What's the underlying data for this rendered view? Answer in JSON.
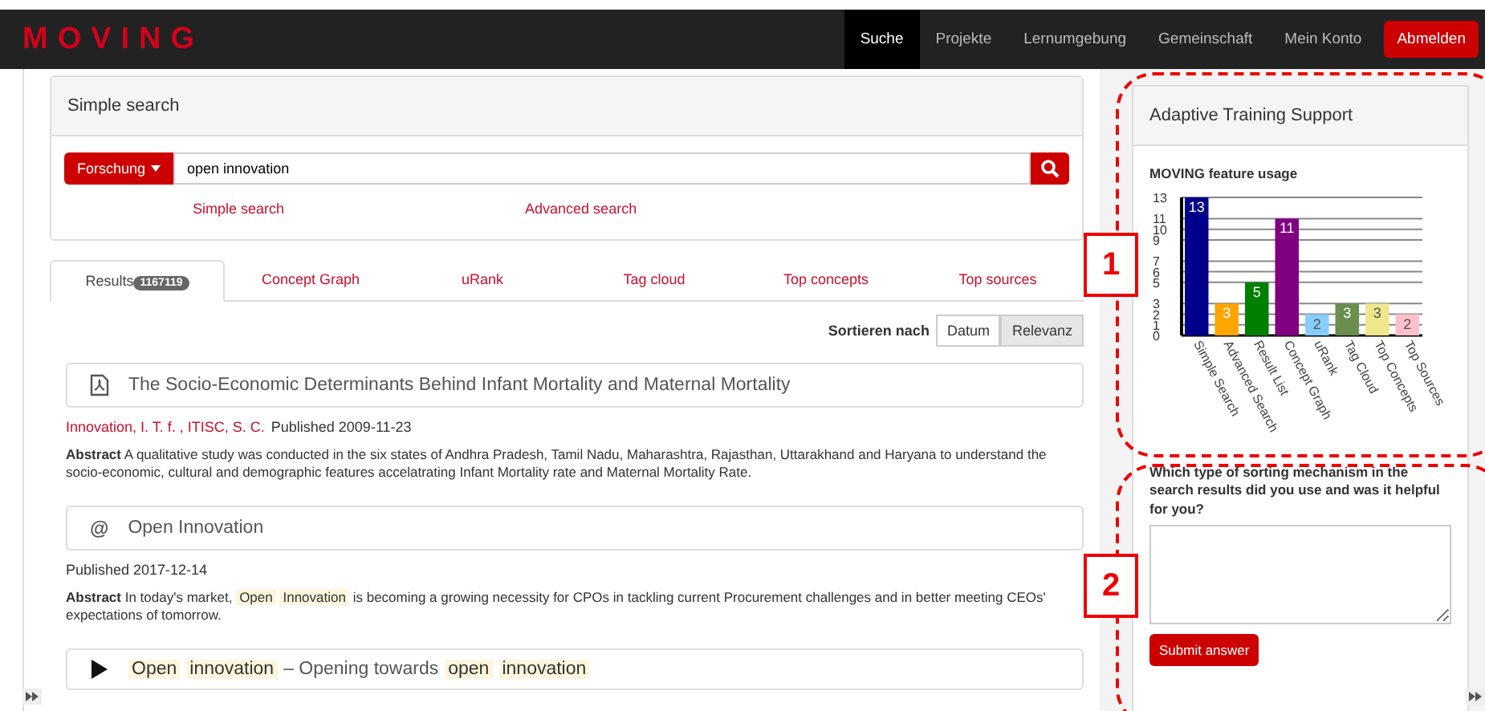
{
  "navbar": {
    "logo": "MOVING",
    "items": [
      {
        "label": "Suche",
        "selected": true
      },
      {
        "label": "Projekte",
        "selected": false
      },
      {
        "label": "Lernumgebung",
        "selected": false
      },
      {
        "label": "Gemeinschaft",
        "selected": false
      },
      {
        "label": "Mein Konto",
        "selected": false
      }
    ],
    "logout": "Abmelden"
  },
  "search": {
    "title": "Simple search",
    "scope": "Forschung",
    "value": "open innovation",
    "links": [
      "Simple search",
      "Advanced search"
    ]
  },
  "tabs": [
    {
      "label": "Results",
      "badge": "1167119",
      "selected": true
    },
    {
      "label": "Concept Graph",
      "selected": false
    },
    {
      "label": "uRank",
      "selected": false
    },
    {
      "label": "Tag cloud",
      "selected": false
    },
    {
      "label": "Top concepts",
      "selected": false
    },
    {
      "label": "Top sources",
      "selected": false
    }
  ],
  "sort": {
    "label": "Sortieren nach",
    "options": [
      {
        "label": "Datum",
        "selected": false
      },
      {
        "label": "Relevanz",
        "selected": true
      }
    ]
  },
  "results": [
    {
      "kind": "pdf",
      "title": "The Socio-Economic Determinants Behind Infant Mortality and Maternal Mortality",
      "authors": "Innovation, I. T. f. , ITISC, S. C.",
      "published": "Published 2009-11-23",
      "abstract_label": "Abstract",
      "abstract": "A qualitative study was conducted in the six states of Andhra Pradesh, Tamil Nadu, Maharashtra, Rajasthan, Uttarakhand and Haryana to understand the socio-economic, cultural and demographic features accelatrating Infant Mortality rate and Maternal Mortality Rate."
    },
    {
      "kind": "web",
      "icon": "@",
      "title": "Open Innovation",
      "published": "Published 2017-12-14",
      "abstract_label": "Abstract",
      "abstract_parts": [
        {
          "text": "In today's market,",
          "highlight": false
        },
        {
          "text": "Open",
          "highlight": true
        },
        {
          "text": "Innovation",
          "highlight": true
        },
        {
          "text": "is becoming a growing necessity for CPOs in tackling current Procurement challenges and in better meeting CEOs' expectations of tomorrow.",
          "highlight": false
        }
      ]
    },
    {
      "kind": "video",
      "title_parts": [
        {
          "text": "Open",
          "highlight": true
        },
        {
          "text": "innovation",
          "highlight": true
        },
        {
          "text": "– Opening towards",
          "highlight": false
        },
        {
          "text": "open",
          "highlight": true
        },
        {
          "text": "innovation",
          "highlight": true
        }
      ]
    }
  ],
  "sidebar": {
    "title": "Adaptive Training Support",
    "chart_title": "MOVING feature usage",
    "chart_data": {
      "type": "bar",
      "categories": [
        "Simple Search",
        "Advanced Search",
        "Result List",
        "Concept Graph",
        "uRank",
        "Tag Cloud",
        "Top Concepts",
        "Top Sources"
      ],
      "values": [
        13,
        3,
        5,
        11,
        2,
        3,
        3,
        2
      ],
      "grid": true,
      "colors": [
        "#00008b",
        "#ffa500",
        "#008000",
        "#800080",
        "#87cefa",
        "#6b8e4e",
        "#f0e68c",
        "#ffc0cb"
      ],
      "ylim": [
        0,
        13
      ],
      "yticks": [
        0,
        1,
        2,
        3,
        5,
        6,
        7,
        9,
        10,
        11,
        13
      ],
      "data_labels": true
    },
    "question": "Which type of sorting mechanism in the search results did you use and was it helpful for you?",
    "submit": "Submit answer"
  },
  "annotations": [
    {
      "label": "1"
    },
    {
      "label": "2"
    }
  ]
}
